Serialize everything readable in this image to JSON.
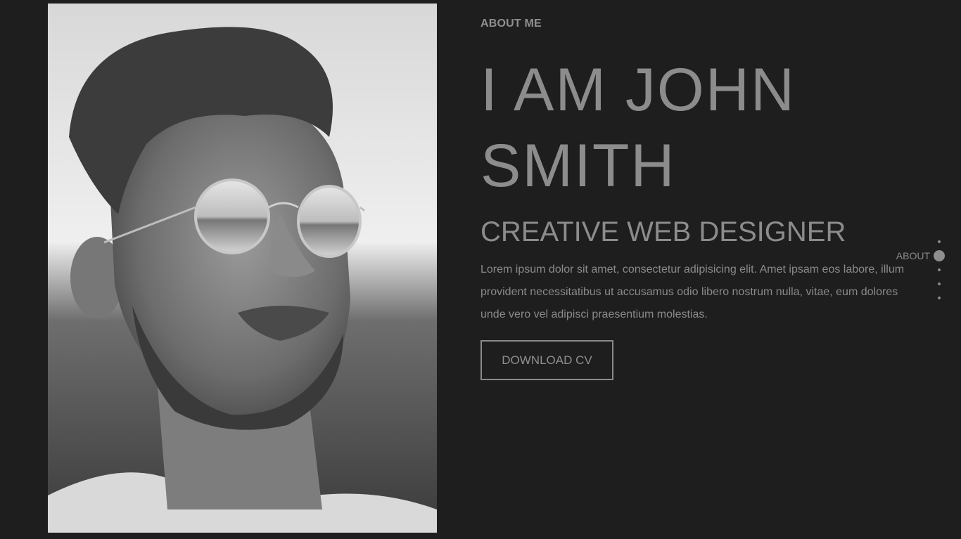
{
  "about": {
    "eyebrow": "ABOUT ME",
    "name_line1": "I AM JOHN",
    "name_line2": "SMITH",
    "role": "CREATIVE WEB DESIGNER",
    "bio": "Lorem ipsum dolor sit amet, consectetur adipisicing elit. Amet ipsam eos labore, illum provident necessitatibus ut accusamus odio libero nostrum nulla, vitae, eum dolores unde vero vel adipisci praesentium molestias.",
    "cta_label": "DOWNLOAD CV"
  },
  "side_nav": {
    "active_label": "ABOUT",
    "dots_count_note": "5"
  },
  "colors": {
    "background": "#1e1e1e",
    "text": "#8c8c8c"
  }
}
